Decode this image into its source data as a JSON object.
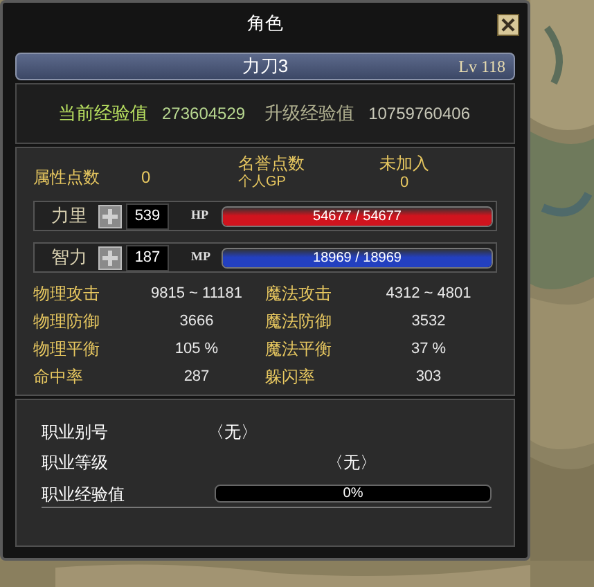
{
  "window": {
    "title": "角色"
  },
  "character": {
    "name": "力刀3",
    "level": "Lv 118"
  },
  "experience": [
    {
      "label": "当前经验值",
      "value": "273604529",
      "highlight": true
    },
    {
      "label": "升级经验值",
      "value": "10759760406",
      "highlight": false
    }
  ],
  "attribute_points": {
    "label": "属性点数",
    "value": "0"
  },
  "honor": {
    "label": "名誉点数",
    "value": "未加入",
    "sub_label": "个人GP",
    "sub_value": "0"
  },
  "attributes": [
    {
      "label": "力里",
      "value": "539",
      "bar_label": "HP",
      "reading": "54677 / 54677",
      "level": 1,
      "color": "#d0141e"
    },
    {
      "label": "智力",
      "value": "187",
      "bar_label": "MP",
      "reading": "18969 / 18969",
      "level": 1,
      "color": "#2340c0"
    }
  ],
  "stats": [
    {
      "label": "物理攻击",
      "value": "9815 ~ 11181"
    },
    {
      "label": "魔法攻击",
      "value": "4312 ~ 4801"
    },
    {
      "label": "物理防御",
      "value": "3666"
    },
    {
      "label": "魔法防御",
      "value": "3532"
    },
    {
      "label": "物理平衡",
      "value": "105 %"
    },
    {
      "label": "魔法平衡",
      "value": "37 %"
    },
    {
      "label": "命中率",
      "value": "287"
    },
    {
      "label": "躲闪率",
      "value": "303"
    }
  ],
  "job": {
    "rows": [
      {
        "label": "职业别号",
        "value": "〈无〉"
      },
      {
        "label": "职业等级",
        "value": "〈无〉"
      }
    ],
    "exp": {
      "label": "职业经验值",
      "level": 0,
      "reading": "0%"
    }
  }
}
